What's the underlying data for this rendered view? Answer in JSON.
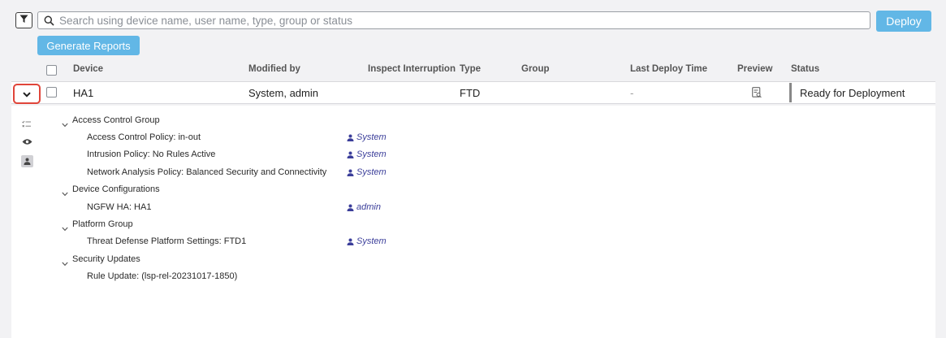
{
  "toolbar": {
    "search_placeholder": "Search using device name, user name, type, group or status",
    "deploy_label": "Deploy",
    "generate_reports_label": "Generate Reports"
  },
  "table": {
    "columns": [
      "Device",
      "Modified by",
      "Inspect Interruption",
      "Type",
      "Group",
      "Last Deploy Time",
      "Preview",
      "Status"
    ],
    "rows": [
      {
        "device": "HA1",
        "modified_by": "System, admin",
        "inspect_interruption": "",
        "type": "FTD",
        "group": "",
        "last_deploy_time": "-",
        "status": "Ready for Deployment"
      }
    ]
  },
  "details": {
    "groups": [
      {
        "name": "Access Control Group",
        "items": [
          {
            "label": "Access Control Policy: in-out",
            "user": "System"
          },
          {
            "label": "Intrusion Policy: No Rules Active",
            "user": "System"
          },
          {
            "label": "Network Analysis Policy: Balanced Security and Connectivity",
            "user": "System"
          }
        ]
      },
      {
        "name": "Device Configurations",
        "items": [
          {
            "label": "NGFW HA: HA1",
            "user": "admin"
          }
        ]
      },
      {
        "name": "Platform Group",
        "items": [
          {
            "label": "Threat Defense Platform Settings: FTD1",
            "user": "System"
          }
        ]
      },
      {
        "name": "Security Updates",
        "items": [
          {
            "label": "Rule Update: (lsp-rel-20231017-1850)",
            "user": ""
          }
        ]
      }
    ]
  },
  "colors": {
    "accent": "#62b7e6",
    "highlight": "#e0453a",
    "user_link": "#3b3e9a"
  }
}
